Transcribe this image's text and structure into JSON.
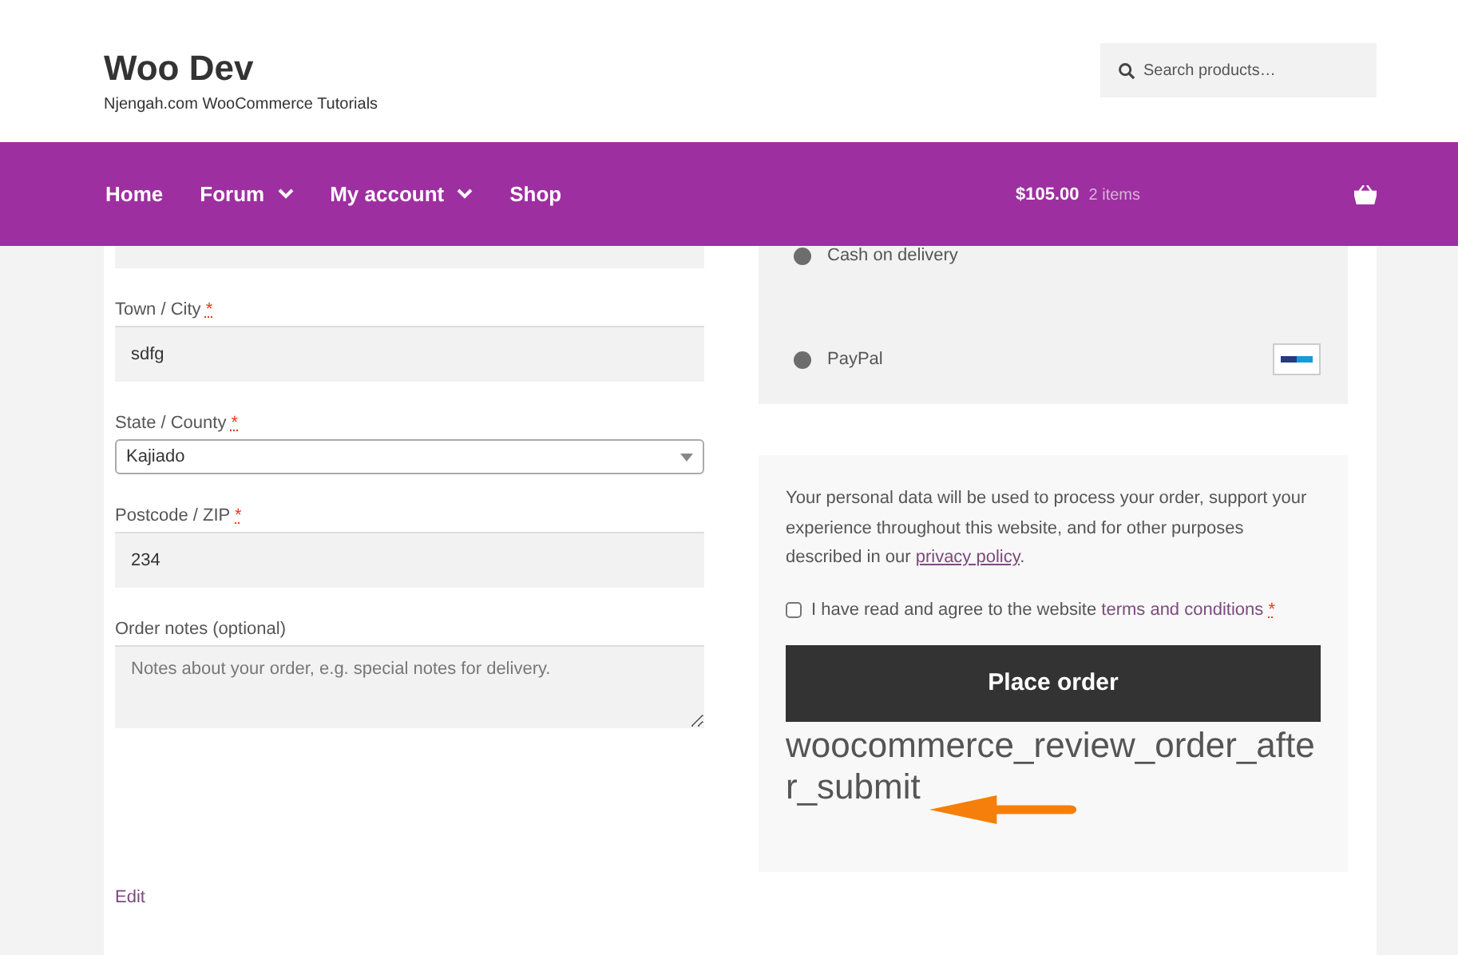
{
  "site": {
    "title": "Woo Dev",
    "tagline": "Njengah.com WooCommerce Tutorials"
  },
  "search": {
    "placeholder": "Search products…"
  },
  "nav": [
    {
      "label": "Home",
      "dropdown": false
    },
    {
      "label": "Forum",
      "dropdown": true
    },
    {
      "label": "My account",
      "dropdown": true
    },
    {
      "label": "Shop",
      "dropdown": false
    }
  ],
  "cart": {
    "total": "$105.00",
    "count": "2 items"
  },
  "billing_fields": [
    {
      "kind": "text",
      "label": "Town / City",
      "required_mark": "*",
      "value": "sdfg"
    },
    {
      "kind": "select",
      "label": "State / County",
      "required_mark": "*",
      "value": "Kajiado"
    },
    {
      "kind": "text",
      "label": "Postcode / ZIP",
      "required_mark": "*",
      "value": "234"
    },
    {
      "kind": "textarea",
      "label": "Order notes (optional)",
      "placeholder": "Notes about your order, e.g. special notes for delivery."
    }
  ],
  "edit_link": "Edit",
  "payment_methods": [
    {
      "label": "Cash on delivery",
      "selected": false,
      "logo": false
    },
    {
      "label": "PayPal",
      "selected": false,
      "logo": true
    }
  ],
  "privacy": {
    "text": "Your personal data will be used to process your order, support your experience throughout this website, and for other purposes described in our",
    "link": "privacy policy",
    "end": "."
  },
  "terms": {
    "checked": false,
    "text": "I have read and agree to the website",
    "link": "terms and conditions",
    "required_mark": "*"
  },
  "place_order": "Place order",
  "hook_note": "woocommerce_review_order_after_submit"
}
